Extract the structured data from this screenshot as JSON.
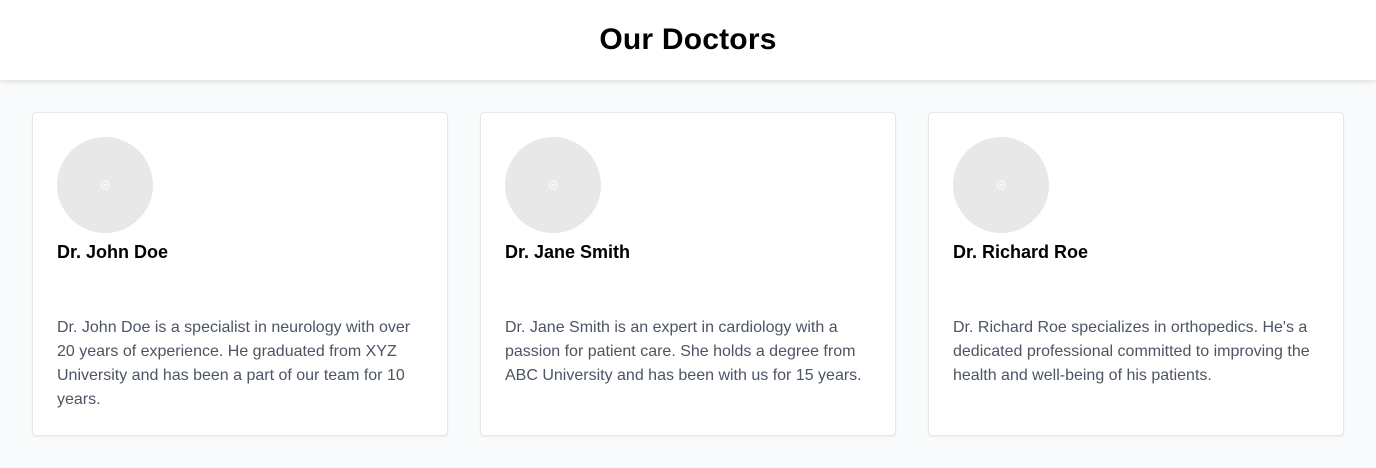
{
  "header": {
    "title": "Our Doctors"
  },
  "doctors": [
    {
      "name": "Dr. John Doe",
      "bio": "Dr. John Doe is a specialist in neurology with over 20 years of experience. He graduated from XYZ University and has been a part of our team for 10 years.",
      "avatar_icon": "image-placeholder-icon"
    },
    {
      "name": "Dr. Jane Smith",
      "bio": "Dr. Jane Smith is an expert in cardiology with a passion for patient care. She holds a degree from ABC University and has been with us for 15 years.",
      "avatar_icon": "image-placeholder-icon"
    },
    {
      "name": "Dr. Richard Roe",
      "bio": "Dr. Richard Roe specializes in orthopedics. He's a dedicated professional committed to improving the health and well-being of his patients.",
      "avatar_icon": "image-placeholder-icon"
    }
  ],
  "colors": {
    "header_bg": "#ffffff",
    "page_bg": "#f9fafb",
    "card_border": "#e5e7eb",
    "avatar_bg": "#e8e8e8",
    "bio_text": "#4b5563"
  }
}
